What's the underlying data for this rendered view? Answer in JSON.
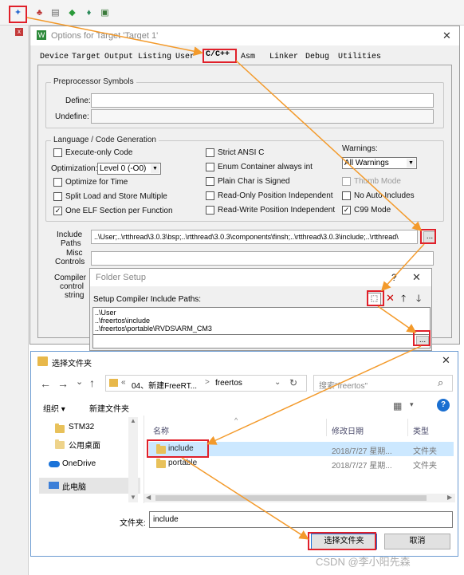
{
  "toolbar": {
    "icons": [
      "target-options-icon",
      "load-icon",
      "build-icon",
      "download-icon",
      "translate-icon",
      "packs-icon"
    ]
  },
  "options_dialog": {
    "title": "Options for Target 'Target 1'",
    "close": "✕",
    "tabs": [
      "Device",
      "Target",
      "Output",
      "Listing",
      "User",
      "C/C++",
      "Asm",
      "Linker",
      "Debug",
      "Utilities"
    ],
    "preprocessor": {
      "legend": "Preprocessor Symbols",
      "define_label": "Define:",
      "define_value": "",
      "undefine_label": "Undefine:",
      "undefine_value": ""
    },
    "language": {
      "legend": "Language / Code Generation",
      "execute_only": "Execute-only Code",
      "optimization_label": "Optimization:",
      "optimization_value": "Level 0 (-O0)",
      "optimize_time": "Optimize for Time",
      "split_load": "Split Load and Store Multiple",
      "one_elf": "One ELF Section per Function",
      "strict_ansi": "Strict ANSI C",
      "enum_container": "Enum Container always int",
      "plain_char": "Plain Char is Signed",
      "ro_pos": "Read-Only Position Independent",
      "rw_pos": "Read-Write Position Independent",
      "warnings_label": "Warnings:",
      "warnings_value": "All Warnings",
      "thumb_mode": "Thumb Mode",
      "no_auto_includes": "No Auto Includes",
      "c99_mode": "C99 Mode"
    },
    "include_paths_label_1": "Include",
    "include_paths_label_2": "Paths",
    "include_paths_value": "..\\User;..\\rtthread\\3.0.3\\bsp;..\\rtthread\\3.0.3\\components\\finsh;..\\rtthread\\3.0.3\\include;..\\rtthread\\",
    "misc_label_1": "Misc",
    "misc_label_2": "Controls",
    "compiler_label_1": "Compiler",
    "compiler_label_2": "control",
    "compiler_label_3": "string",
    "browse": "..."
  },
  "folder_setup": {
    "title": "Folder Setup",
    "help": "?",
    "close": "✕",
    "list_label": "Setup Compiler Include Paths:",
    "paths": [
      "..\\User",
      "..\\freertos\\include",
      "..\\freertos\\portable\\RVDS\\ARM_CM3"
    ],
    "browse": "..."
  },
  "select_folder": {
    "title": "选择文件夹",
    "close": "✕",
    "back": "←",
    "forward": "→",
    "dropdown": "⌄",
    "up": "↑",
    "breadcrumb_prefix": "«",
    "breadcrumb_1": "04、新建FreeRT...",
    "breadcrumb_sep": ">",
    "breadcrumb_2": "freertos",
    "refresh": "↻",
    "search_placeholder": "搜索\"freertos\"",
    "organize": "组织 ▾",
    "new_folder": "新建文件夹",
    "help": "?",
    "nav_items": [
      "STM32",
      "公用桌面",
      "OneDrive",
      "此电脑"
    ],
    "columns": [
      "名称",
      "修改日期",
      "类型"
    ],
    "rows": [
      {
        "name": "include",
        "date": "2018/7/27 星期...",
        "type": "文件夹"
      },
      {
        "name": "portable",
        "date": "2018/7/27 星期...",
        "type": "文件夹"
      }
    ],
    "folder_label": "文件夹:",
    "folder_value": "include",
    "select_button": "选择文件夹",
    "cancel_button": "取消"
  },
  "watermark": "CSDN @李小阳先森",
  "colors": {
    "highlight": "#e0202a",
    "arrow": "#f39a2b",
    "selection": "#cce8ff"
  }
}
